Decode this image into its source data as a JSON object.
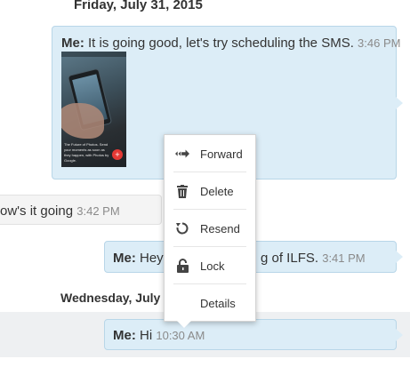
{
  "conversation": {
    "date_1": "Friday, July 31, 2015",
    "date_2": "Wednesday, July",
    "messages": [
      {
        "sender": "Me:",
        "text": " It is going good, let's try scheduling the SMS.",
        "time": "3:46 PM",
        "attachment": {
          "type": "photo",
          "caption": "The Future of Photos. Send your moments as soon as they happen, with Photos by Google.",
          "action_glyph": "+"
        }
      },
      {
        "sender": "",
        "text": "ow's it going",
        "time": "3:42 PM"
      },
      {
        "sender": "Me:",
        "text": " Hey",
        "text_tail": "g of ILFS.",
        "time": "3:41 PM"
      },
      {
        "sender": "Me:",
        "text": " Hi",
        "time": "10:30 AM"
      }
    ]
  },
  "context_menu": {
    "items": [
      {
        "label": "Forward",
        "icon": "forward-icon"
      },
      {
        "label": "Delete",
        "icon": "trash-icon"
      },
      {
        "label": "Resend",
        "icon": "resend-icon"
      },
      {
        "label": "Lock",
        "icon": "lock-icon"
      },
      {
        "label": "Details",
        "icon": ""
      }
    ]
  },
  "colors": {
    "outgoing_bubble": "#dcedf7",
    "outgoing_border": "#b8d6e8",
    "incoming_bubble": "#f4f4f4",
    "time_text": "#8a8a8a"
  }
}
